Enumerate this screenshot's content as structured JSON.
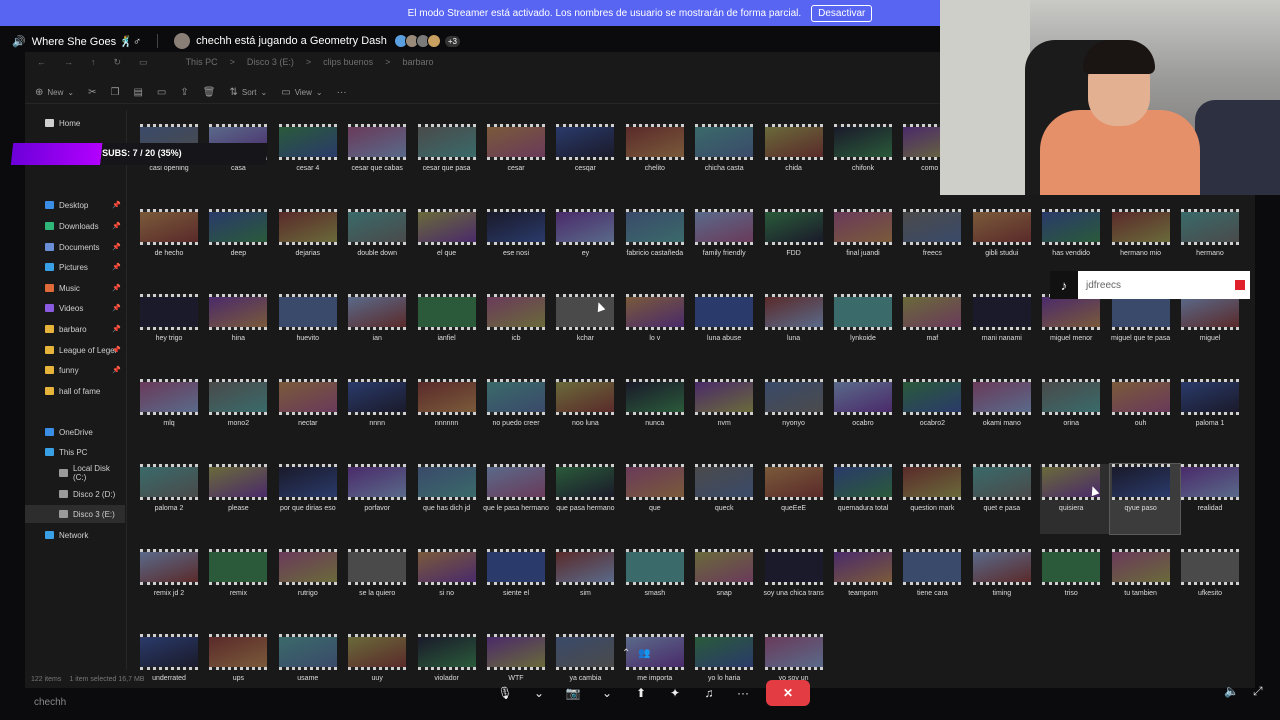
{
  "banner": {
    "message": "El modo Streamer está activado. Los nombres de usuario se mostrarán de forma parcial.",
    "button": "Desactivar"
  },
  "stream_header": {
    "channel": "Where She Goes 🕺♂",
    "activity": "chechh está jugando a Geometry Dash",
    "viewer_extra": "+3"
  },
  "explorer": {
    "breadcrumbs": [
      "This PC",
      ">",
      "Disco 3 (E:)",
      ">",
      "clips buenos",
      ">",
      "barbaro"
    ],
    "toolbar": {
      "new": "New",
      "sort": "Sort",
      "view": "View"
    },
    "sidebar": [
      {
        "label": "Home",
        "color": "#d0d0d0",
        "pinned": false
      },
      {
        "label": "Desktop",
        "color": "#3a8ee6",
        "pinned": true
      },
      {
        "label": "Downloads",
        "color": "#2fb77a",
        "pinned": true
      },
      {
        "label": "Documents",
        "color": "#6a8fd6",
        "pinned": true
      },
      {
        "label": "Pictures",
        "color": "#3aa0e6",
        "pinned": true
      },
      {
        "label": "Music",
        "color": "#e06a3a",
        "pinned": true
      },
      {
        "label": "Videos",
        "color": "#8a5ae0",
        "pinned": true
      },
      {
        "label": "barbaro",
        "color": "#e6b43a",
        "pinned": true
      },
      {
        "label": "League of Leger",
        "color": "#e6b43a",
        "pinned": true
      },
      {
        "label": "funny",
        "color": "#e6b43a",
        "pinned": true
      },
      {
        "label": "hall of fame",
        "color": "#e6b43a",
        "pinned": false
      },
      {
        "label": "OneDrive",
        "color": "#3a8ee6",
        "pinned": false
      },
      {
        "label": "This PC",
        "color": "#3aa0e6",
        "pinned": false
      },
      {
        "label": "Local Disk (C:)",
        "color": "#9a9a9a",
        "pinned": false
      },
      {
        "label": "Disco 2 (D:)",
        "color": "#9a9a9a",
        "pinned": false
      },
      {
        "label": "Disco 3 (E:)",
        "color": "#9a9a9a",
        "pinned": false
      },
      {
        "label": "Network",
        "color": "#3aa0e6",
        "pinned": false
      }
    ],
    "status": {
      "items": "122 items",
      "selected": "1 item selected  16,7 MB"
    },
    "files": [
      [
        "casi opening",
        "casa",
        "cesar 4",
        "cesar que cabas",
        "cesar que pasa",
        "cesar",
        "cesqar",
        "chelito",
        "chicha casta",
        "chida",
        "chifonk",
        "como s"
      ],
      [
        "de hecho",
        "deep",
        "dejarias",
        "double down",
        "el que",
        "ese nosi",
        "ey",
        "fabricio castañeda",
        "family friendly",
        "FDD",
        "final juandi",
        "freecs",
        "gibli studui",
        "has vendido",
        "hermano mio",
        "hermano"
      ],
      [
        "hey trigo",
        "hina",
        "huevito",
        "ian",
        "ianfiel",
        "icb",
        "kchar",
        "lo v",
        "luna abuse",
        "luna",
        "lynkoide",
        "maf",
        "mani nanami",
        "miguel menor",
        "miguel que te pasa",
        "miguel"
      ],
      [
        "mlq",
        "mono2",
        "nectar",
        "nnnn",
        "nnnnnn",
        "no puedo creer",
        "noo luna",
        "nunca",
        "nvm",
        "nyonyo",
        "ocabro",
        "ocabro2",
        "okami mano",
        "orina",
        "ouh",
        "paloma 1"
      ],
      [
        "paloma 2",
        "please",
        "por que dirias eso",
        "porfavor",
        "que has dich jd",
        "que le pasa hermano",
        "que pasa hermano",
        "que",
        "queck",
        "queEeE",
        "quemadura total",
        "question mark",
        "quet e pasa",
        "quisiera",
        "qyue paso",
        "realidad"
      ],
      [
        "remix jd 2",
        "remix",
        "rutrigo",
        "se la quiero",
        "si no",
        "siente el",
        "sim",
        "smash",
        "snap",
        "soy una chica trans",
        "teamporn",
        "tiene cara",
        "timing",
        "triso",
        "tu tambien",
        "ufkesito"
      ],
      [
        "underrated",
        "ups",
        "usame",
        "uuy",
        "violador",
        "WTF",
        "ya cambia",
        "me importa",
        "yo lo haria",
        "yo soy un"
      ]
    ]
  },
  "subs_bar": {
    "text": "SUBS: 7 / 20 (35%)",
    "progress": 0.35
  },
  "tiktok": {
    "handle": "jdfreecs"
  },
  "bottom": {
    "username": "chechh"
  }
}
